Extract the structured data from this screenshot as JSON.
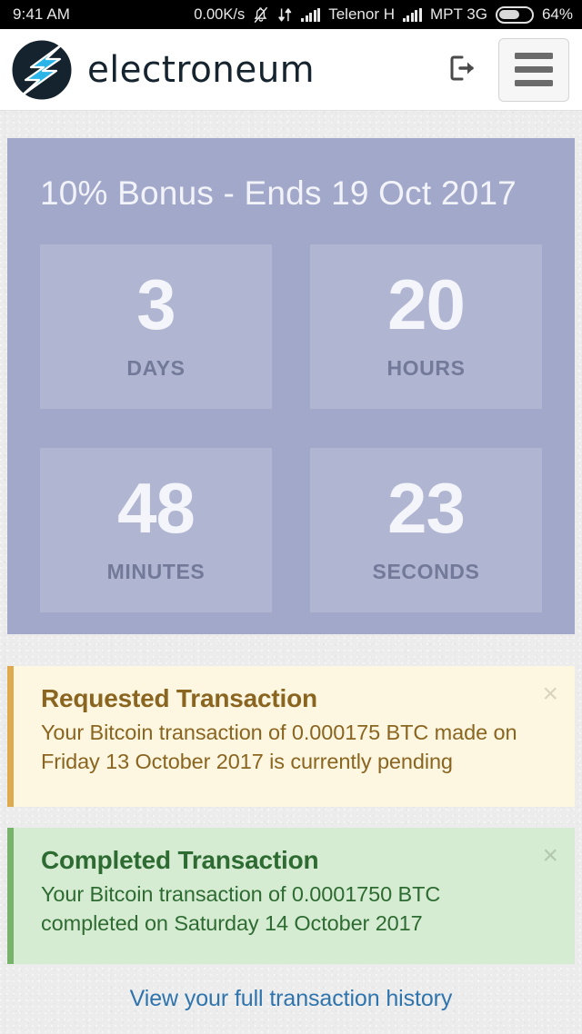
{
  "status_bar": {
    "clock": "9:41 AM",
    "data_speed": "0.00K/s",
    "icons": [
      "bell-muted-icon",
      "data-transfer-icon",
      "signal-bars-icon"
    ],
    "carrier_primary": "Telenor H",
    "carrier_secondary": "MPT 3G",
    "battery_percent": "64%",
    "battery_level": 64
  },
  "header": {
    "brand_name": "electroneum",
    "logo": "electroneum-bolt-logo",
    "logout_label": "logout-icon",
    "menu_label": "hamburger-menu-icon",
    "colors": {
      "logo_dark": "#15232e",
      "logo_cyan": "#2ab4e8",
      "wordmark": "#16242f"
    }
  },
  "countdown": {
    "title": "10% Bonus - Ends 19 Oct 2017",
    "background": "#a2a8ca",
    "cell_background": "#b0b5d2",
    "units": [
      {
        "value": "3",
        "label": "DAYS"
      },
      {
        "value": "20",
        "label": "HOURS"
      },
      {
        "value": "48",
        "label": "MINUTES"
      },
      {
        "value": "23",
        "label": "SECONDS"
      }
    ]
  },
  "alerts": [
    {
      "type": "warning",
      "title": "Requested Transaction",
      "body": "Your Bitcoin transaction of 0.000175 BTC made on Friday 13 October 2017 is currently pending",
      "close_label": "×",
      "background": "#fdf6e1",
      "accent": "#ddab4d",
      "text_color": "#8a6520"
    },
    {
      "type": "success",
      "title": "Completed Transaction",
      "body": "Your Bitcoin transaction of 0.0001750 BTC completed on Saturday 14 October 2017",
      "close_label": "×",
      "background": "#d6ecd2",
      "accent": "#77b36a",
      "text_color": "#2d6b32"
    }
  ],
  "footer": {
    "history_link": "View your full transaction history",
    "link_color": "#2f74ad"
  }
}
